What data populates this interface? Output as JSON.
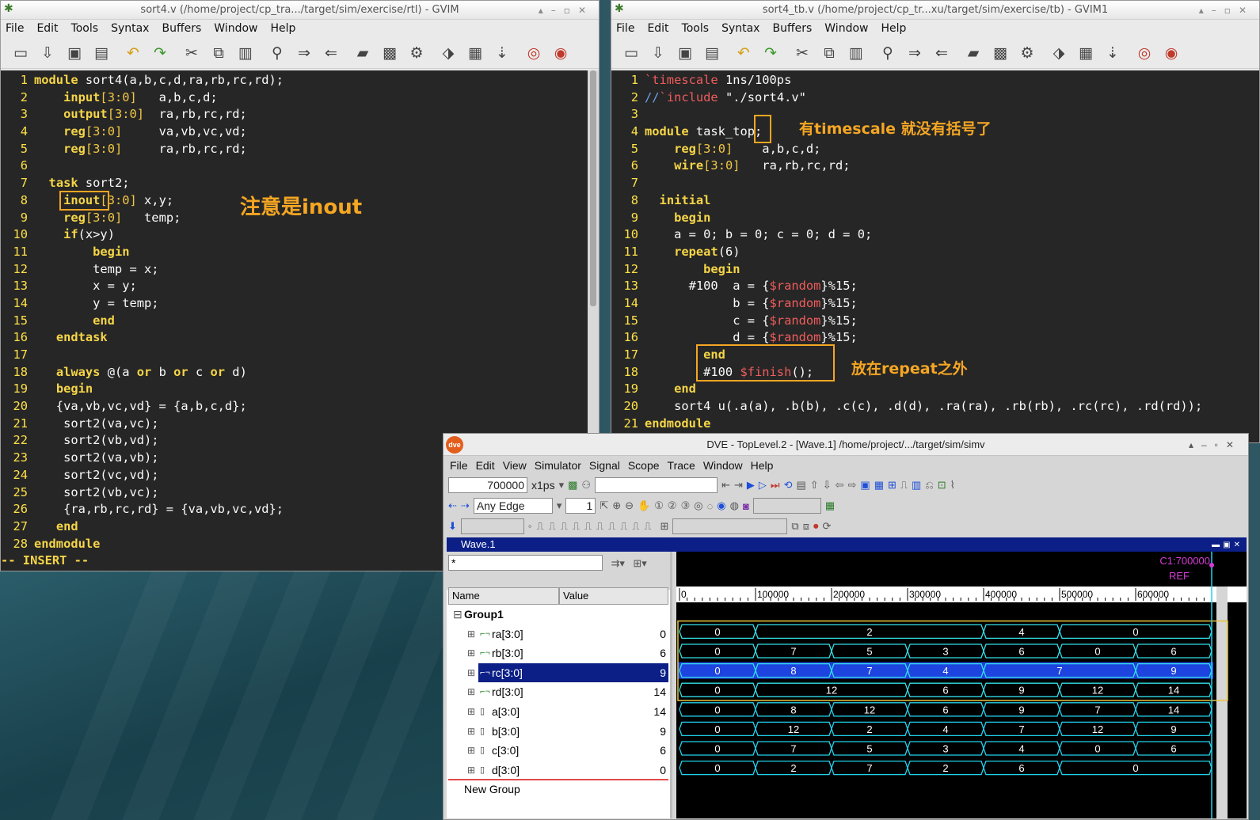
{
  "left_window": {
    "title": "sort4.v (/home/project/cp_tra.../target/sim/exercise/rtl) - GVIM",
    "menu": [
      "File",
      "Edit",
      "Tools",
      "Syntax",
      "Buffers",
      "Window",
      "Help"
    ],
    "status": "-- INSERT --",
    "code": [
      "module sort4(a,b,c,d,ra,rb,rc,rd);",
      "    input[3:0]   a,b,c,d;",
      "    output[3:0]  ra,rb,rc,rd;",
      "    reg[3:0]     va,vb,vc,vd;",
      "    reg[3:0]     ra,rb,rc,rd;",
      "",
      "  task sort2;",
      "    inout[3:0] x,y;",
      "    reg[3:0]   temp;",
      "    if(x>y)",
      "        begin",
      "        temp = x;",
      "        x = y;",
      "        y = temp;",
      "        end",
      "   endtask",
      "",
      "   always @(a or b or c or d)",
      "   begin",
      "   {va,vb,vc,vd} = {a,b,c,d};",
      "    sort2(va,vc);",
      "    sort2(vb,vd);",
      "    sort2(va,vb);",
      "    sort2(vc,vd);",
      "    sort2(vb,vc);",
      "    {ra,rb,rc,rd} = {va,vb,vc,vd};",
      "   end",
      "endmodule"
    ],
    "annotation": "注意是inout"
  },
  "right_window": {
    "title": "sort4_tb.v (/home/project/cp_tr...xu/target/sim/exercise/tb) - GVIM1",
    "menu": [
      "File",
      "Edit",
      "Tools",
      "Syntax",
      "Buffers",
      "Window",
      "Help"
    ],
    "code": [
      "`timescale 1ns/100ps",
      "//`include \"./sort4.v\"",
      "",
      "module task_top;",
      "    reg[3:0]    a,b,c,d;",
      "    wire[3:0]   ra,rb,rc,rd;",
      "",
      "  initial",
      "    begin",
      "    a = 0; b = 0; c = 0; d = 0;",
      "    repeat(6)",
      "        begin",
      "      #100  a = {$random}%15;",
      "            b = {$random}%15;",
      "            c = {$random}%15;",
      "            d = {$random}%15;",
      "        end",
      "        #100 $finish();",
      "    end",
      "    sort4 u(.a(a), .b(b), .c(c), .d(d), .ra(ra), .rb(rb), .rc(rc), .rd(rd));",
      "endmodule"
    ],
    "annotation1": "有timescale 就没有括号了",
    "annotation2": "放在repeat之外"
  },
  "dve": {
    "title": "DVE - TopLevel.2 - [Wave.1]  /home/project/.../target/sim/simv",
    "logo": "dve",
    "menu": [
      "File",
      "Edit",
      "View",
      "Simulator",
      "Signal",
      "Scope",
      "Trace",
      "Window",
      "Help"
    ],
    "time_value": "700000",
    "time_unit": "x1ps",
    "edge": "Any Edge",
    "step": "1",
    "wave_title": "Wave.1",
    "filter": "*",
    "col_name": "Name",
    "col_value": "Value",
    "group": "Group1",
    "new_group": "New Group",
    "cursor_label": "C1:700000",
    "ref_label": "REF",
    "signals": [
      {
        "name": "ra[3:0]",
        "value": "0",
        "kind": "out",
        "selected": false
      },
      {
        "name": "rb[3:0]",
        "value": "6",
        "kind": "out",
        "selected": false
      },
      {
        "name": "rc[3:0]",
        "value": "9",
        "kind": "out",
        "selected": true
      },
      {
        "name": "rd[3:0]",
        "value": "14",
        "kind": "out",
        "selected": false
      },
      {
        "name": "a[3:0]",
        "value": "14",
        "kind": "reg",
        "selected": false
      },
      {
        "name": "b[3:0]",
        "value": "9",
        "kind": "reg",
        "selected": false
      },
      {
        "name": "c[3:0]",
        "value": "6",
        "kind": "reg",
        "selected": false
      },
      {
        "name": "d[3:0]",
        "value": "0",
        "kind": "reg",
        "selected": false
      }
    ]
  },
  "chart_data": {
    "type": "waveform",
    "time_unit": "ps",
    "xlim": [
      0,
      700000
    ],
    "ticks": [
      0,
      100000,
      200000,
      300000,
      400000,
      500000,
      600000
    ],
    "tick_labels": [
      "0",
      "100000",
      "200000",
      "300000",
      "400000",
      "500000",
      "600000"
    ],
    "cursor": 700000,
    "series": [
      {
        "name": "ra[3:0]",
        "segments": [
          [
            0,
            100000,
            "0"
          ],
          [
            100000,
            400000,
            "2"
          ],
          [
            400000,
            500000,
            "4"
          ],
          [
            500000,
            700000,
            "0"
          ]
        ]
      },
      {
        "name": "rb[3:0]",
        "segments": [
          [
            0,
            100000,
            "0"
          ],
          [
            100000,
            200000,
            "7"
          ],
          [
            200000,
            300000,
            "5"
          ],
          [
            300000,
            400000,
            "3"
          ],
          [
            400000,
            500000,
            "6"
          ],
          [
            500000,
            600000,
            "0"
          ],
          [
            600000,
            700000,
            "6"
          ]
        ]
      },
      {
        "name": "rc[3:0]",
        "segments": [
          [
            0,
            100000,
            "0"
          ],
          [
            100000,
            200000,
            "8"
          ],
          [
            200000,
            300000,
            "7"
          ],
          [
            300000,
            400000,
            "4"
          ],
          [
            400000,
            600000,
            "7"
          ],
          [
            600000,
            700000,
            "9"
          ]
        ]
      },
      {
        "name": "rd[3:0]",
        "segments": [
          [
            0,
            100000,
            "0"
          ],
          [
            100000,
            300000,
            "12"
          ],
          [
            300000,
            400000,
            "6"
          ],
          [
            400000,
            500000,
            "9"
          ],
          [
            500000,
            600000,
            "12"
          ],
          [
            600000,
            700000,
            "14"
          ]
        ]
      },
      {
        "name": "a[3:0]",
        "segments": [
          [
            0,
            100000,
            "0"
          ],
          [
            100000,
            200000,
            "8"
          ],
          [
            200000,
            300000,
            "12"
          ],
          [
            300000,
            400000,
            "6"
          ],
          [
            400000,
            500000,
            "9"
          ],
          [
            500000,
            600000,
            "7"
          ],
          [
            600000,
            700000,
            "14"
          ]
        ]
      },
      {
        "name": "b[3:0]",
        "segments": [
          [
            0,
            100000,
            "0"
          ],
          [
            100000,
            200000,
            "12"
          ],
          [
            200000,
            300000,
            "2"
          ],
          [
            300000,
            400000,
            "4"
          ],
          [
            400000,
            500000,
            "7"
          ],
          [
            500000,
            600000,
            "12"
          ],
          [
            600000,
            700000,
            "9"
          ]
        ]
      },
      {
        "name": "c[3:0]",
        "segments": [
          [
            0,
            100000,
            "0"
          ],
          [
            100000,
            200000,
            "7"
          ],
          [
            200000,
            300000,
            "5"
          ],
          [
            300000,
            400000,
            "3"
          ],
          [
            400000,
            500000,
            "4"
          ],
          [
            500000,
            600000,
            "0"
          ],
          [
            600000,
            700000,
            "6"
          ]
        ]
      },
      {
        "name": "d[3:0]",
        "segments": [
          [
            0,
            100000,
            "0"
          ],
          [
            100000,
            200000,
            "2"
          ],
          [
            200000,
            300000,
            "7"
          ],
          [
            300000,
            400000,
            "2"
          ],
          [
            400000,
            500000,
            "6"
          ],
          [
            500000,
            700000,
            "0"
          ]
        ]
      }
    ]
  },
  "colors": {
    "editor_bg": "#262626",
    "line_number": "#fde047",
    "keyword": "#f5d547",
    "annotation": "#f5a623",
    "dve_title_blue": "#0b1f87",
    "wave_cyan": "#22d3ee",
    "wave_green": "#32cd32",
    "wave_selected_fill": "#1e44e0"
  }
}
